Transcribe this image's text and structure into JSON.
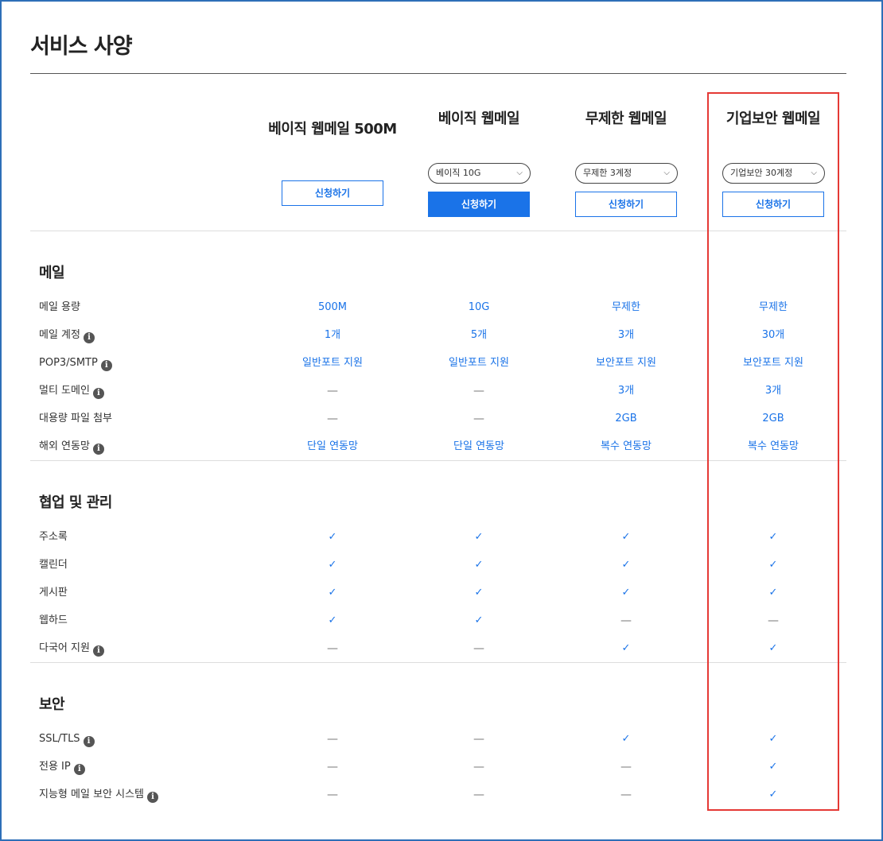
{
  "page": {
    "title": "서비스 사양"
  },
  "plans": [
    {
      "name": "베이직 웹메일 500M",
      "select": null,
      "button_label": "신청하기",
      "primary": false
    },
    {
      "name": "베이직 웹메일",
      "select": "베이직 10G",
      "button_label": "신청하기",
      "primary": true
    },
    {
      "name": "무제한 웹메일",
      "select": "무제한 3계정",
      "button_label": "신청하기",
      "primary": false
    },
    {
      "name": "기업보안 웹메일",
      "select": "기업보안 30계정",
      "button_label": "신청하기",
      "primary": false
    }
  ],
  "icons": {
    "info": "info-icon",
    "check": "check-icon",
    "dash": "dash-icon",
    "select_chevron": "chevron-down-icon"
  },
  "colors": {
    "accent": "#1a73e8",
    "highlight": "#e53935",
    "frame": "#2d6fb8"
  },
  "sections": [
    {
      "title": "메일",
      "rows": [
        {
          "label": "메일 용량",
          "info": false,
          "values": [
            "500M",
            "10G",
            "무제한",
            "무제한"
          ]
        },
        {
          "label": "메일 계정",
          "info": true,
          "values": [
            "1개",
            "5개",
            "3개",
            "30개"
          ]
        },
        {
          "label": "POP3/SMTP",
          "info": true,
          "values": [
            "일반포트 지원",
            "일반포트 지원",
            "보안포트 지원",
            "보안포트 지원"
          ]
        },
        {
          "label": "멀티 도메인",
          "info": true,
          "values": [
            "—",
            "—",
            "3개",
            "3개"
          ]
        },
        {
          "label": "대용량 파일 첨부",
          "info": false,
          "values": [
            "—",
            "—",
            "2GB",
            "2GB"
          ]
        },
        {
          "label": "해외 연동망",
          "info": true,
          "values": [
            "단일 연동망",
            "단일 연동망",
            "복수 연동망",
            "복수 연동망"
          ]
        }
      ]
    },
    {
      "title": "협업 및 관리",
      "rows": [
        {
          "label": "주소록",
          "info": false,
          "values": [
            "✓",
            "✓",
            "✓",
            "✓"
          ]
        },
        {
          "label": "캘린더",
          "info": false,
          "values": [
            "✓",
            "✓",
            "✓",
            "✓"
          ]
        },
        {
          "label": "게시판",
          "info": false,
          "values": [
            "✓",
            "✓",
            "✓",
            "✓"
          ]
        },
        {
          "label": "웹하드",
          "info": false,
          "values": [
            "✓",
            "✓",
            "—",
            "—"
          ]
        },
        {
          "label": "다국어 지원",
          "info": true,
          "values": [
            "—",
            "—",
            "✓",
            "✓"
          ]
        }
      ]
    },
    {
      "title": "보안",
      "rows": [
        {
          "label": "SSL/TLS",
          "info": true,
          "values": [
            "—",
            "—",
            "✓",
            "✓"
          ]
        },
        {
          "label": "전용 IP",
          "info": true,
          "values": [
            "—",
            "—",
            "—",
            "✓"
          ]
        },
        {
          "label": "지능형 메일 보안 시스템",
          "info": true,
          "values": [
            "—",
            "—",
            "—",
            "✓"
          ]
        }
      ]
    }
  ]
}
